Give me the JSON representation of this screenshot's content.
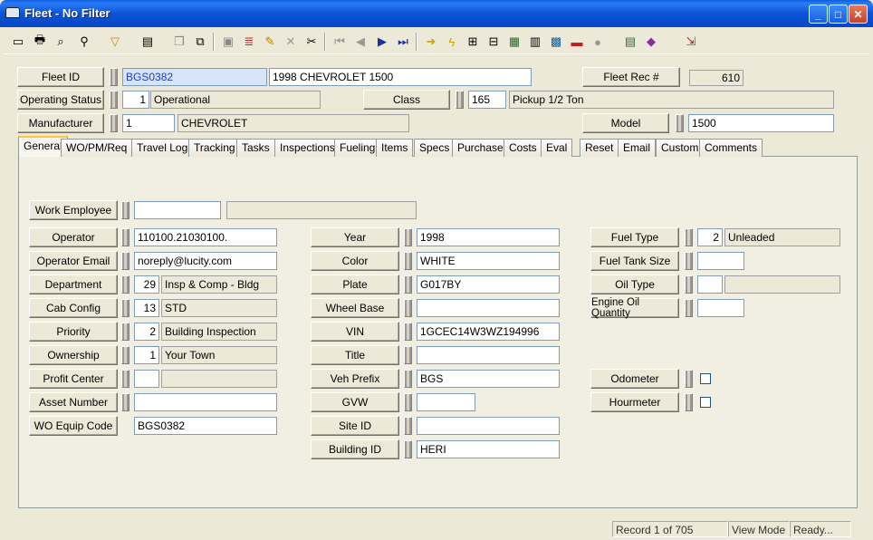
{
  "window": {
    "title": "Fleet - No Filter",
    "buttons": {
      "minimize": "_",
      "maximize": "□",
      "close": "✕"
    }
  },
  "toolbar": {
    "icons": [
      "new",
      "print",
      "print-preview",
      "search",
      "filter",
      "report",
      "copy",
      "paste",
      "save",
      "edit",
      "delete",
      "cut",
      "first",
      "previous",
      "next",
      "last",
      "jump",
      "lightning",
      "hierarchy",
      "map",
      "calculator",
      "gis",
      "calendar",
      "parts",
      "globe",
      "spreadsheet",
      "book",
      "exit"
    ]
  },
  "header": {
    "fleet_id": {
      "label": "Fleet ID",
      "value": "BGS0382",
      "description": "1998 CHEVROLET 1500"
    },
    "fleet_rec": {
      "label": "Fleet Rec #",
      "value": "610"
    },
    "operating_status": {
      "label": "Operating Status",
      "code": "1",
      "description": "Operational"
    },
    "class": {
      "label": "Class",
      "code": "165",
      "description": "Pickup 1/2 Ton"
    },
    "manufacturer": {
      "label": "Manufacturer",
      "code": "1",
      "description": "CHEVROLET"
    },
    "model": {
      "label": "Model",
      "value": "1500"
    }
  },
  "tabs": [
    "General",
    "WO/PM/Req",
    "Travel Log",
    "Tracking",
    "Tasks",
    "Inspections",
    "Fueling",
    "Items",
    "Specs",
    "Purchase",
    "Costs",
    "Eval",
    "Reset",
    "Email",
    "Custom",
    "Comments"
  ],
  "general": {
    "work_employee": {
      "label": "Work Employee",
      "code": "",
      "description": ""
    },
    "left": [
      {
        "label": "Operator",
        "value": "110100.21030100."
      },
      {
        "label": "Operator Email",
        "value": "noreply@lucity.com"
      },
      {
        "label": "Department",
        "code": "29",
        "description": "Insp & Comp - Bldg"
      },
      {
        "label": "Cab Config",
        "code": "13",
        "description": "STD"
      },
      {
        "label": "Priority",
        "code": "2",
        "description": "Building Inspection"
      },
      {
        "label": "Ownership",
        "code": "1",
        "description": "Your Town"
      },
      {
        "label": "Profit Center",
        "code": "",
        "description": ""
      },
      {
        "label": "Asset Number",
        "value": ""
      },
      {
        "label": "WO Equip Code",
        "value": "BGS0382"
      }
    ],
    "middle": [
      {
        "label": "Year",
        "value": "1998"
      },
      {
        "label": "Color",
        "value": "WHITE"
      },
      {
        "label": "Plate",
        "value": "G017BY"
      },
      {
        "label": "Wheel Base",
        "value": ""
      },
      {
        "label": "VIN",
        "value": "1GCEC14W3WZ194996"
      },
      {
        "label": "Title",
        "value": ""
      },
      {
        "label": "Veh Prefix",
        "value": "BGS"
      },
      {
        "label": "GVW",
        "value": ""
      },
      {
        "label": "Site ID",
        "value": ""
      },
      {
        "label": "Building ID",
        "value": "HERI"
      }
    ],
    "right": [
      {
        "label": "Fuel Type",
        "code": "2",
        "description": "Unleaded"
      },
      {
        "label": "Fuel Tank Size",
        "value": ""
      },
      {
        "label": "Oil Type",
        "code": "",
        "description": ""
      },
      {
        "label": "Engine Oil Quantity",
        "value": ""
      },
      {
        "label": "Odometer",
        "checked": false
      },
      {
        "label": "Hourmeter",
        "checked": false
      }
    ]
  },
  "statusbar": {
    "record": "Record 1 of 705",
    "mode": "View Mode",
    "state": "Ready..."
  }
}
